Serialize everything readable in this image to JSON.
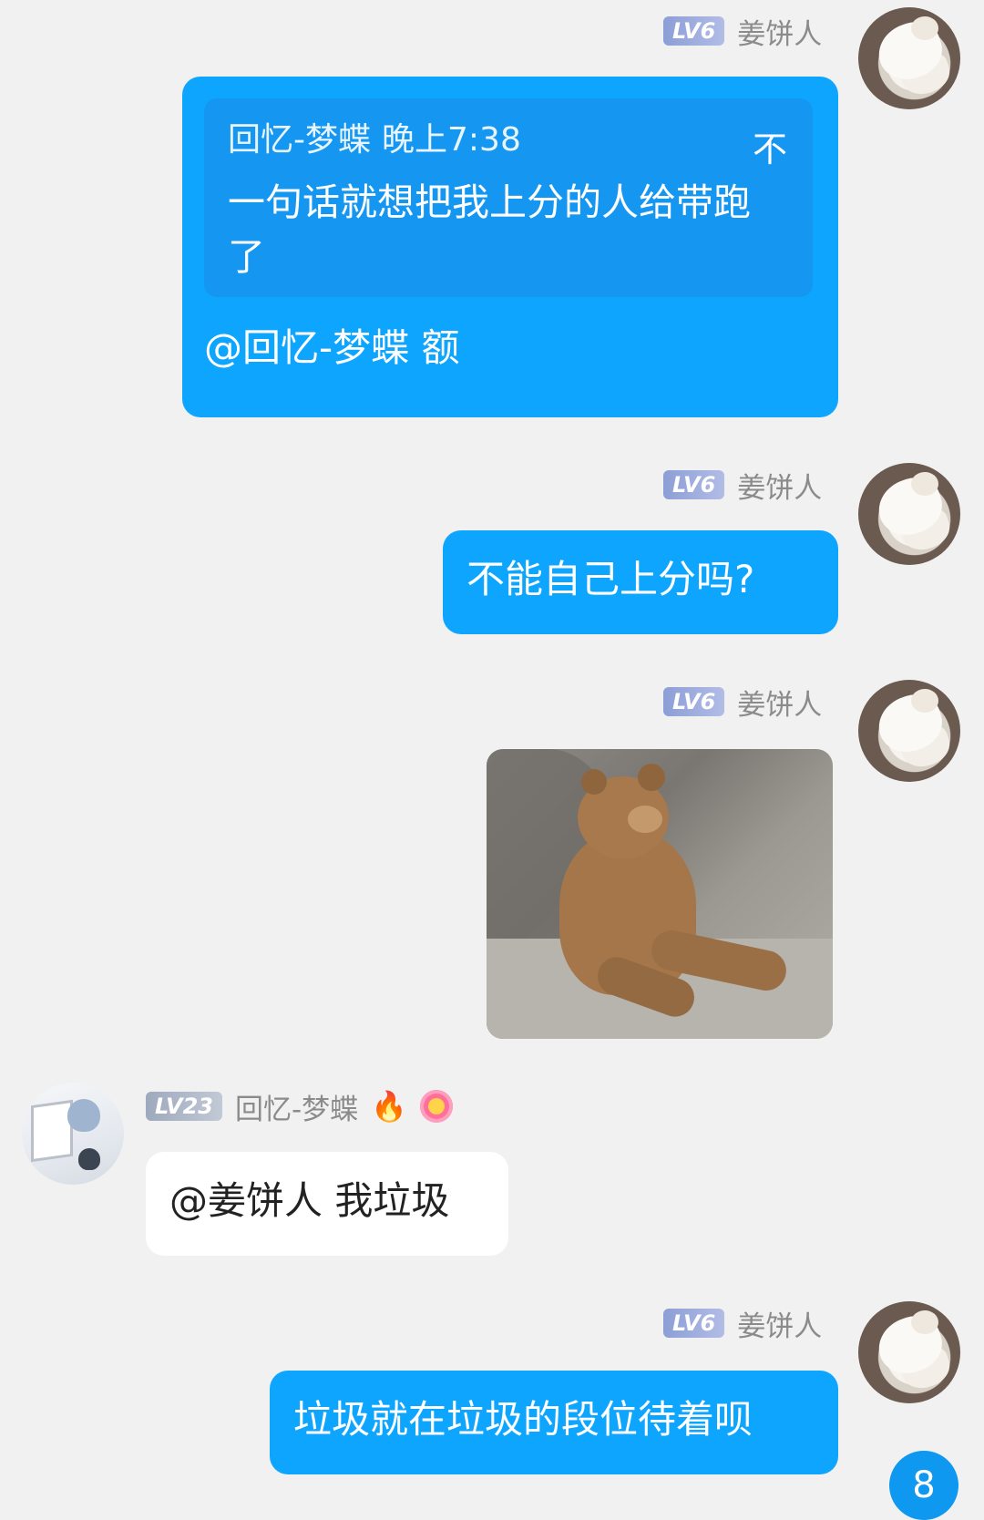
{
  "messages": [
    {
      "sender": "姜饼人",
      "level": "LV6",
      "reply": {
        "author": "回忆-梦蝶",
        "time": "晚上7:38",
        "mark": "不",
        "text": "一句话就想把我上分的人给带跑了"
      },
      "text": "@回忆-梦蝶 额"
    },
    {
      "sender": "姜饼人",
      "level": "LV6",
      "text": "不能自己上分吗?"
    },
    {
      "sender": "姜饼人",
      "level": "LV6",
      "image": "bear-sitting-meme"
    },
    {
      "sender": "回忆-梦蝶",
      "level": "LV23",
      "text": "@姜饼人 我垃圾",
      "badges": [
        "fire-emoji",
        "flower-emoji"
      ]
    },
    {
      "sender": "姜饼人",
      "level": "LV6",
      "text": "垃圾就在垃圾的段位待着呗"
    }
  ],
  "unread_count": "8",
  "colors": {
    "self_bubble": "#0ea5ff",
    "background": "#f1f1f1",
    "other_bubble": "#ffffff"
  }
}
